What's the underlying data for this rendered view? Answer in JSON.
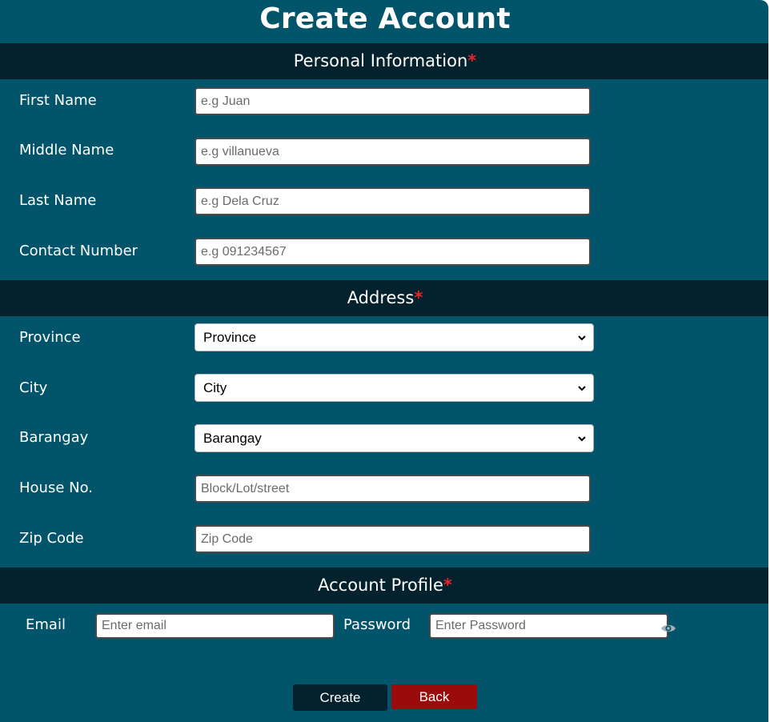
{
  "page": {
    "title": "Create Account"
  },
  "sections": {
    "personal": {
      "title": "Personal Information",
      "required_mark": "*"
    },
    "address": {
      "title": "Address",
      "required_mark": "*"
    },
    "account": {
      "title": "Account Profile",
      "required_mark": "*"
    }
  },
  "personal": {
    "first_name": {
      "label": "First Name",
      "placeholder": "e.g Juan",
      "value": ""
    },
    "middle_name": {
      "label": "Middle Name",
      "placeholder": "e.g villanueva",
      "value": ""
    },
    "last_name": {
      "label": "Last Name",
      "placeholder": "e.g Dela Cruz",
      "value": ""
    },
    "contact_number": {
      "label": "Contact Number",
      "placeholder": "e.g 091234567",
      "value": ""
    }
  },
  "address": {
    "province": {
      "label": "Province",
      "selected": "Province"
    },
    "city": {
      "label": "City",
      "selected": "City"
    },
    "barangay": {
      "label": "Barangay",
      "selected": "Barangay"
    },
    "house_no": {
      "label": "House No.",
      "placeholder": "Block/Lot/street",
      "value": ""
    },
    "zip_code": {
      "label": "Zip Code",
      "placeholder": "Zip Code",
      "value": ""
    }
  },
  "account": {
    "email": {
      "label": "Email",
      "placeholder": "Enter email",
      "value": ""
    },
    "password": {
      "label": "Password",
      "placeholder": "Enter Password",
      "value": ""
    },
    "password_toggle_icon": "eye-icon"
  },
  "buttons": {
    "create": "Create",
    "back": "Back"
  },
  "colors": {
    "background": "#02546b",
    "section_bar": "#04222d",
    "required": "#e8252b",
    "create_button": "#04222d",
    "back_button": "#9c0b0b"
  }
}
